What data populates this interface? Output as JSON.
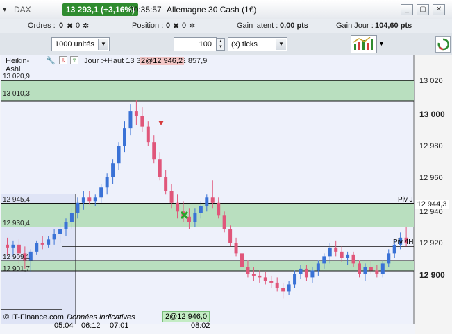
{
  "window": {
    "menu_glyph": "▾",
    "symbol": "DAX",
    "price_change": "13 293,1 (+3,16%)",
    "time": "20:35:57",
    "instrument": "Allemagne 30 Cash (1€)",
    "min_label": "_",
    "max_label": "▢",
    "close_label": "✕"
  },
  "info": {
    "orders_label": "Ordres :",
    "orders_value": "0",
    "orders_secondary": "0",
    "position_label": "Position :",
    "position_value": "0",
    "position_secondary": "0",
    "latent_label": "Gain latent :",
    "latent_value": "0,00 pts",
    "day_label": "Gain Jour :",
    "day_value": "104,60 pts"
  },
  "toolbar": {
    "units": "1000 unités",
    "quantity": "100",
    "ticks": "(x) ticks"
  },
  "chart": {
    "indicator": "Heikin-Ashi",
    "legend": "Jour :+Haut 13 303,8 +Bas 12 857,9",
    "legend_overlay": "2@12 946,2",
    "levels": [
      "13 020,9",
      "13 010,3",
      "12 945,4",
      "12 930,4",
      "12 909,1",
      "12 901,7"
    ],
    "axis": [
      "13 020",
      "13 000",
      "12 980",
      "12 960",
      "12 940",
      "12 920",
      "12 900"
    ],
    "current_price": "12 944,3",
    "piv_j": "Piv J",
    "piv_4h": "Piv 4H",
    "times": [
      "05:04",
      "06:12",
      "07:01",
      "08:02"
    ],
    "footer": "© IT-Finance.com",
    "footer_note": "Données indicatives",
    "order_tag": "2@12 946,0"
  },
  "chart_data": {
    "type": "candlestick",
    "style": "heikin-ashi",
    "y_range": [
      12885,
      13040
    ],
    "candles": [
      [
        12931,
        12935,
        12925,
        12929
      ],
      [
        12929,
        12933,
        12924,
        12931
      ],
      [
        12931,
        12934,
        12920,
        12926
      ],
      [
        12926,
        12930,
        12917,
        12922
      ],
      [
        12922,
        12928,
        12915,
        12927
      ],
      [
        12927,
        12933,
        12925,
        12932
      ],
      [
        12932,
        12936,
        12928,
        12931
      ],
      [
        12931,
        12936,
        12929,
        12934
      ],
      [
        12934,
        12940,
        12931,
        12937
      ],
      [
        12937,
        12943,
        12932,
        12940
      ],
      [
        12940,
        12946,
        12936,
        12944
      ],
      [
        12944,
        12952,
        12940,
        12949
      ],
      [
        12949,
        12958,
        12946,
        12955
      ],
      [
        12955,
        12962,
        12951,
        12958
      ],
      [
        12958,
        12962,
        12954,
        12956
      ],
      [
        12956,
        12960,
        12953,
        12958
      ],
      [
        12958,
        12966,
        12955,
        12964
      ],
      [
        12964,
        12972,
        12960,
        12970
      ],
      [
        12970,
        12980,
        12966,
        12978
      ],
      [
        12978,
        12990,
        12974,
        12988
      ],
      [
        12988,
        13002,
        12984,
        12998
      ],
      [
        12998,
        13012,
        12994,
        13008
      ],
      [
        13008,
        13014,
        13000,
        13005
      ],
      [
        13005,
        13010,
        12996,
        12999
      ],
      [
        12999,
        13002,
        12988,
        12990
      ],
      [
        12990,
        12994,
        12978,
        12980
      ],
      [
        12980,
        12984,
        12968,
        12970
      ],
      [
        12970,
        12974,
        12960,
        12962
      ],
      [
        12962,
        12966,
        12952,
        12955
      ],
      [
        12955,
        12960,
        12946,
        12950
      ],
      [
        12950,
        12956,
        12944,
        12947
      ],
      [
        12947,
        12952,
        12940,
        12944
      ],
      [
        12944,
        12952,
        12941,
        12949
      ],
      [
        12949,
        12956,
        12946,
        12953
      ],
      [
        12953,
        12960,
        12950,
        12958
      ],
      [
        12958,
        12968,
        12952,
        12955
      ],
      [
        12955,
        12958,
        12946,
        12948
      ],
      [
        12948,
        12950,
        12938,
        12940
      ],
      [
        12940,
        12942,
        12930,
        12932
      ],
      [
        12932,
        12935,
        12924,
        12926
      ],
      [
        12926,
        12929,
        12916,
        12918
      ],
      [
        12918,
        12922,
        12912,
        12914
      ],
      [
        12914,
        12918,
        12910,
        12913
      ],
      [
        12913,
        12916,
        12909,
        12912
      ],
      [
        12912,
        12915,
        12908,
        12910
      ],
      [
        12910,
        12913,
        12906,
        12909
      ],
      [
        12909,
        12912,
        12904,
        12906
      ],
      [
        12906,
        12909,
        12900,
        12904
      ],
      [
        12904,
        12910,
        12902,
        12908
      ],
      [
        12908,
        12916,
        12906,
        12914
      ],
      [
        12914,
        12919,
        12911,
        12917
      ],
      [
        12917,
        12919,
        12910,
        12912
      ],
      [
        12912,
        12918,
        12909,
        12916
      ],
      [
        12916,
        12922,
        12913,
        12920
      ],
      [
        12920,
        12926,
        12917,
        12924
      ],
      [
        12924,
        12932,
        12920,
        12929
      ],
      [
        12929,
        12933,
        12924,
        12927
      ],
      [
        12927,
        12930,
        12921,
        12923
      ],
      [
        12923,
        12927,
        12919,
        12925
      ],
      [
        12925,
        12927,
        12918,
        12920
      ],
      [
        12920,
        12922,
        12912,
        12914
      ],
      [
        12914,
        12920,
        12910,
        12918
      ],
      [
        12918,
        12922,
        12914,
        12916
      ],
      [
        12916,
        12919,
        12912,
        12914
      ],
      [
        12914,
        12922,
        12912,
        12920
      ],
      [
        12920,
        12928,
        12918,
        12926
      ],
      [
        12926,
        12934,
        12923,
        12931
      ],
      [
        12931,
        12938,
        12928,
        12935
      ],
      [
        12935,
        12941,
        12930,
        12932
      ]
    ],
    "levels": [
      13020.9,
      13010.3,
      12945.4,
      12930.4,
      12909.1,
      12901.7
    ],
    "current_price": 12944.3
  },
  "colors": {
    "up": "#3a72d6",
    "down": "#e0567a",
    "band": "#b9dfbf",
    "accent_green": "#2f8b2f"
  }
}
